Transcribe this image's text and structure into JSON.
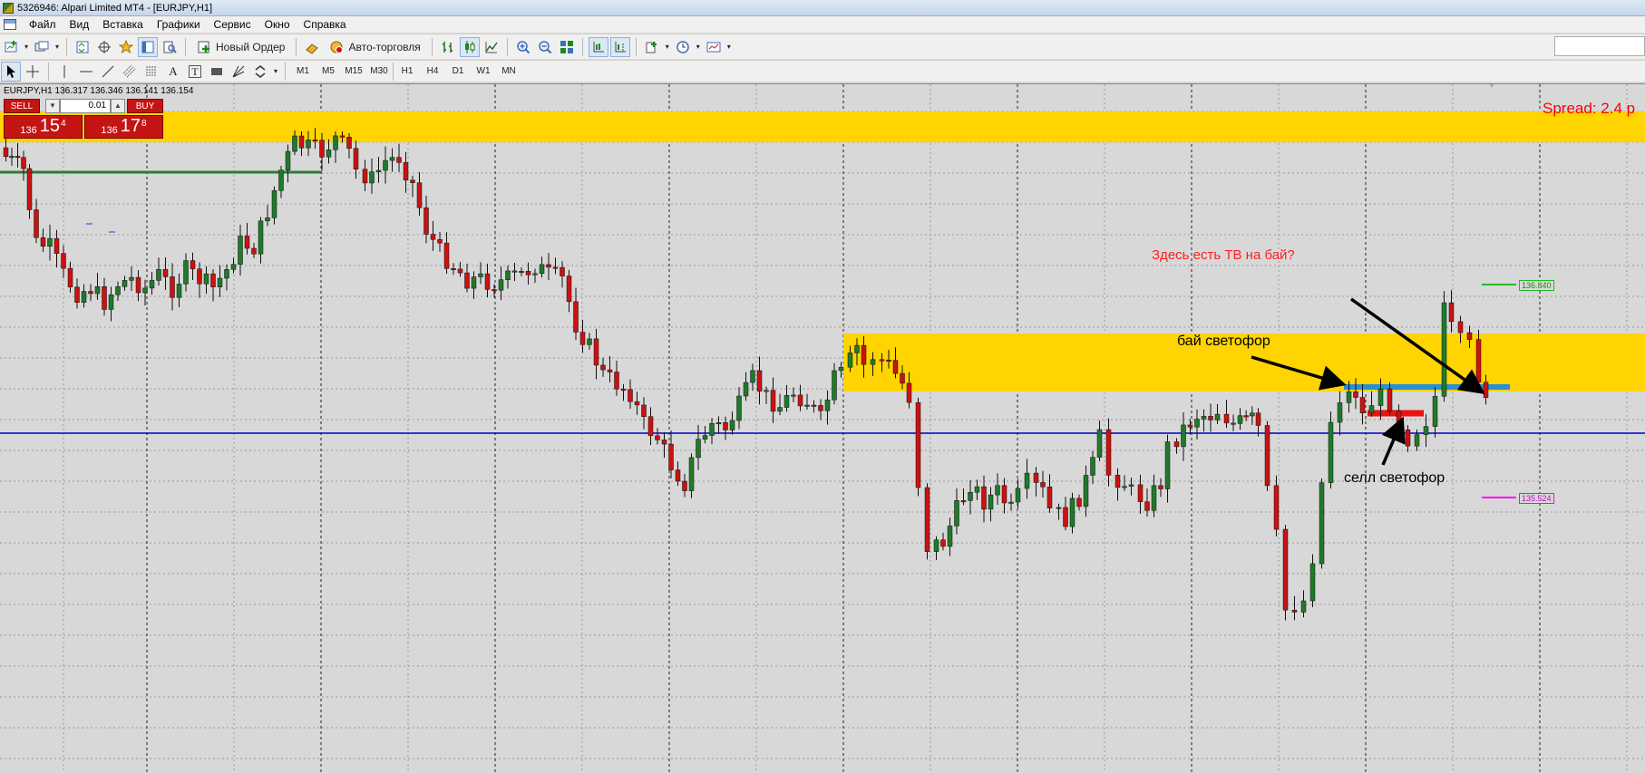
{
  "window": {
    "title": "5326946: Alpari Limited MT4 - [EURJPY,H1]"
  },
  "menu": [
    "Файл",
    "Вид",
    "Вставка",
    "Графики",
    "Сервис",
    "Окно",
    "Справка"
  ],
  "toolbar": {
    "new_order_label": "Новый Ордер",
    "autotrading_label": "Авто-торговля",
    "timeframes": [
      "M1",
      "M5",
      "M15",
      "M30",
      "H1",
      "H4",
      "D1",
      "W1",
      "MN"
    ],
    "drawing_text_tool": "A",
    "drawing_textlabel_tool": "T"
  },
  "chart": {
    "symbol_line": "EURJPY,H1  136.317 136.346 136.141 136.154",
    "symbol": "EURJPY,H1",
    "open": "136.317",
    "high": "136.346",
    "low": "136.141",
    "close": "136.154",
    "spread_label": "Spread: 2.4 p",
    "level_label_green": "136.840",
    "level_label_magenta": "135.524",
    "colors": {
      "background": "#d8d8d8",
      "bull_candle": "#1f7a2a",
      "bear_candle": "#cc1111",
      "grid": "#9a9a9a",
      "zone": "#ffd400",
      "horizontal_line": "#0000cc",
      "green_line": "#2d7a3a",
      "blue_bar": "#2a8fd0",
      "red_bar": "#ee1111"
    }
  },
  "trade_panel": {
    "sell_label": "SELL",
    "buy_label": "BUY",
    "lot_value": "0.01",
    "bid_prefix": "136",
    "bid_big": "15",
    "bid_sup": "4",
    "ask_prefix": "136",
    "ask_big": "17",
    "ask_sup": "8"
  },
  "annotations": {
    "question": "Здесь есть ТВ на бай?",
    "buy_signal": "бай светофор",
    "sell_signal": "селл светофор"
  }
}
